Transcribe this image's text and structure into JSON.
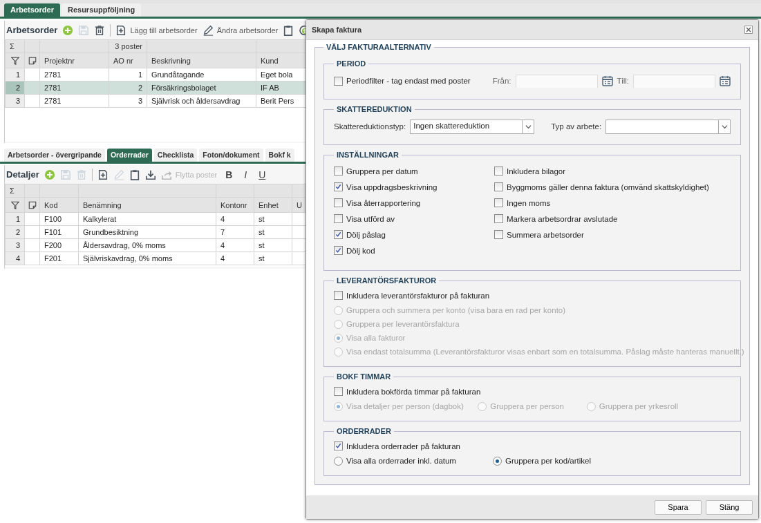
{
  "top_tabs": [
    {
      "label": "Arbetsorder",
      "selected": true
    },
    {
      "label": "Resursuppföljning",
      "selected": false
    }
  ],
  "work_orders": {
    "title": "Arbetsorder",
    "toolbar": [
      {
        "kind": "add",
        "disabled": false
      },
      {
        "kind": "save",
        "disabled": true
      },
      {
        "kind": "delete",
        "disabled": false
      },
      {
        "kind": "separator"
      },
      {
        "kind": "new_doc",
        "label": "Lägg till arbetsorder",
        "disabled": false
      },
      {
        "kind": "edit",
        "label": "Ändra arbetsorder",
        "disabled": false
      },
      {
        "kind": "paste",
        "disabled": false
      },
      {
        "kind": "money",
        "disabled": false
      }
    ],
    "grid": {
      "sum_symbol": "Σ",
      "columns": [
        {
          "label": "Projektnr"
        },
        {
          "label": "AO nr",
          "summary": "3 poster"
        },
        {
          "label": "Beskrivning"
        },
        {
          "label": "Kund"
        }
      ],
      "rows": [
        {
          "number": "1",
          "selected": false,
          "cells": [
            "2781",
            "1",
            "Grundåtagande",
            "Eget bola"
          ]
        },
        {
          "number": "2",
          "selected": true,
          "cells": [
            "2781",
            "2",
            "Försäkringsbolaget",
            "IF AB"
          ]
        },
        {
          "number": "3",
          "selected": false,
          "cells": [
            "2781",
            "3",
            "Självrisk och åldersavdrag",
            "Berit Pers"
          ]
        }
      ]
    }
  },
  "detail_tabs": [
    {
      "label": "Arbetsorder - övergripande",
      "selected": false
    },
    {
      "label": "Orderrader",
      "selected": true
    },
    {
      "label": "Checklista",
      "selected": false
    },
    {
      "label": "Foton/dokument",
      "selected": false
    },
    {
      "label": "Bokf k",
      "selected": false
    }
  ],
  "details": {
    "title": "Detaljer",
    "toolbar": [
      {
        "kind": "add",
        "disabled": false
      },
      {
        "kind": "save",
        "disabled": true
      },
      {
        "kind": "delete",
        "disabled": true
      },
      {
        "kind": "separator"
      },
      {
        "kind": "new_doc",
        "disabled": false
      },
      {
        "kind": "edit",
        "disabled": true
      },
      {
        "kind": "paste",
        "disabled": false
      },
      {
        "kind": "download",
        "disabled": false
      },
      {
        "kind": "move",
        "label": "Flytta poster",
        "disabled": true
      },
      {
        "kind": "bold",
        "label": "B",
        "disabled": false
      },
      {
        "kind": "italic",
        "label": "I",
        "disabled": false
      },
      {
        "kind": "underline",
        "label": "U",
        "disabled": false
      }
    ],
    "grid": {
      "sum_symbol": "Σ",
      "columns": [
        {
          "label": "Kod"
        },
        {
          "label": "Benämning"
        },
        {
          "label": "Kontonr"
        },
        {
          "label": "Enhet"
        },
        {
          "label": "U"
        }
      ],
      "rows": [
        {
          "number": "1",
          "selected": false,
          "cells": [
            "F100",
            "Kalkylerat",
            "4",
            "st"
          ]
        },
        {
          "number": "2",
          "selected": false,
          "cells": [
            "F101",
            "Grundbesiktning",
            "7",
            "st"
          ]
        },
        {
          "number": "3",
          "selected": false,
          "cells": [
            "F200",
            "Åldersavdrag, 0% moms",
            "4",
            "st"
          ]
        },
        {
          "number": "4",
          "selected": false,
          "cells": [
            "F201",
            "Självriskavdrag, 0% moms",
            "4",
            "st"
          ]
        }
      ]
    }
  },
  "dialog": {
    "title": "Skapa faktura",
    "section_title": "VÄLJ FAKTURAALTERNATIV",
    "period": {
      "title": "PERIOD",
      "filter": {
        "label": "Periodfilter - tag endast med poster",
        "checked": false
      },
      "from_label": "Från:",
      "to_label": "Till:"
    },
    "tax_reduction": {
      "title": "SKATTEREDUKTION",
      "type_label": "Skattereduktionstyp:",
      "type_value": "Ingen skattereduktion",
      "work_label": "Typ av arbete:"
    },
    "settings": {
      "title": "INSTÄLLNINGAR",
      "left_column": [
        {
          "label": "Gruppera per datum",
          "checked": false
        },
        {
          "label": "Visa uppdragsbeskrivning",
          "checked": true
        },
        {
          "label": "Visa återrapportering",
          "checked": false
        },
        {
          "label": "Visa utförd av",
          "checked": false
        },
        {
          "label": "Dölj påslag",
          "checked": true
        },
        {
          "label": "Dölj kod",
          "checked": true
        }
      ],
      "right_column": [
        {
          "label": "Inkludera bilagor",
          "checked": false
        },
        {
          "label": "Byggmoms gäller denna faktura (omvänd skattskyldighet)",
          "checked": false
        },
        {
          "label": "Ingen moms",
          "checked": false
        },
        {
          "label": "Markera arbetsordrar avslutade",
          "checked": false
        },
        {
          "label": "Summera arbetsorder",
          "checked": false
        }
      ]
    },
    "supplier_invoices": {
      "title": "LEVERANTÖRSFAKTUROR",
      "include": {
        "label": "Inkludera leverantörsfakturor på fakturan",
        "checked": false
      },
      "options": [
        {
          "label": "Gruppera och summera per konto (visa bara en rad per konto)",
          "selected": false,
          "disabled": true
        },
        {
          "label": "Gruppera per leverantörsfaktura",
          "selected": false,
          "disabled": true
        },
        {
          "label": "Visa alla fakturor",
          "selected": true,
          "disabled": true
        },
        {
          "label": "Visa endast totalsumma (Leverantörsfakturor visas enbart som en totalsumma. Påslag måste hanteras manuellt.)",
          "selected": false,
          "disabled": true
        }
      ]
    },
    "booked_hours": {
      "title": "BOKF TIMMAR",
      "include": {
        "label": "Inkludera bokförda timmar på fakturan",
        "checked": false
      },
      "options": [
        {
          "label": "Visa detaljer per person (dagbok)",
          "selected": true,
          "disabled": true
        },
        {
          "label": "Gruppera per person",
          "selected": false,
          "disabled": true
        },
        {
          "label": "Gruppera per yrkesroll",
          "selected": false,
          "disabled": true
        }
      ]
    },
    "order_rows": {
      "title": "ORDERRADER",
      "include": {
        "label": "Inkludera orderrader på fakturan",
        "checked": true
      },
      "options": [
        {
          "label": "Visa alla orderrader inkl. datum",
          "selected": false,
          "disabled": false
        },
        {
          "label": "Gruppera per kod/artikel",
          "selected": true,
          "disabled": false
        }
      ]
    },
    "buttons": [
      "Spara",
      "Stäng"
    ]
  }
}
